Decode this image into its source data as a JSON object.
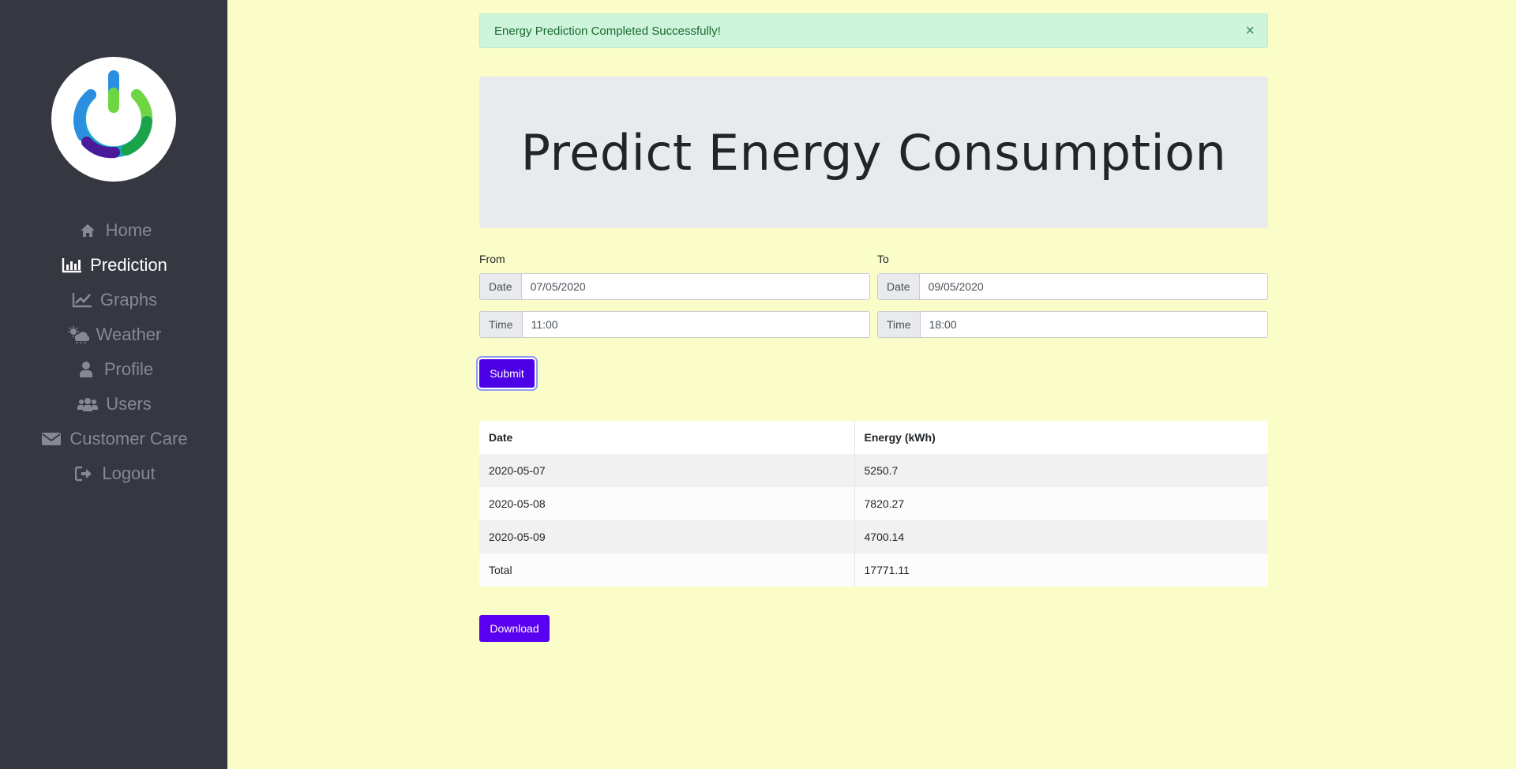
{
  "colors": {
    "page_bg": "#fbfdc8",
    "sidebar_bg": "#353841",
    "nav_inactive": "#868992",
    "nav_active": "#ffffff",
    "primary_button": "#4b00e6",
    "alert_bg": "#cff4dc",
    "alert_text": "#186b32"
  },
  "sidebar": {
    "logo_icon": "power-logo-icon",
    "items": [
      {
        "label": "Home",
        "icon": "home-icon",
        "active": false
      },
      {
        "label": "Prediction",
        "icon": "bar-chart-icon",
        "active": true
      },
      {
        "label": "Graphs",
        "icon": "line-chart-icon",
        "active": false
      },
      {
        "label": "Weather",
        "icon": "weather-icon",
        "active": false
      },
      {
        "label": "Profile",
        "icon": "user-icon",
        "active": false
      },
      {
        "label": "Users",
        "icon": "users-icon",
        "active": false
      },
      {
        "label": "Customer Care",
        "icon": "envelope-icon",
        "active": false
      },
      {
        "label": "Logout",
        "icon": "sign-out-icon",
        "active": false
      }
    ]
  },
  "alert": {
    "message": "Energy Prediction Completed Successfully!",
    "close": "×"
  },
  "page": {
    "title": "Predict Energy Consumption"
  },
  "form": {
    "from_label": "From",
    "to_label": "To",
    "from_date_addon": "Date",
    "from_date_value": "07/05/2020",
    "from_time_addon": "Time",
    "from_time_value": "11:00",
    "to_date_addon": "Date",
    "to_date_value": "09/05/2020",
    "to_time_addon": "Time",
    "to_time_value": "18:00",
    "submit_label": "Submit"
  },
  "results": {
    "headers": [
      "Date",
      "Energy (kWh)"
    ],
    "rows": [
      [
        "2020-05-07",
        "5250.7"
      ],
      [
        "2020-05-08",
        "7820.27"
      ],
      [
        "2020-05-09",
        "4700.14"
      ],
      [
        "Total",
        "17771.11"
      ]
    ]
  },
  "download_label": "Download"
}
